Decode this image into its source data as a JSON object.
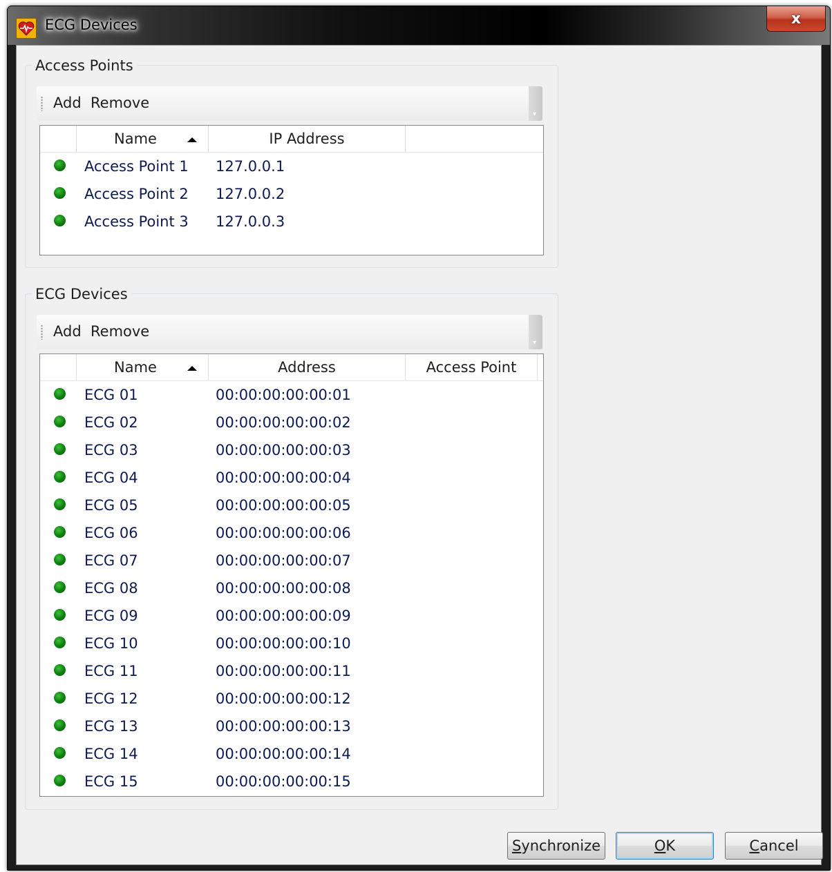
{
  "window": {
    "title": "ECG Devices",
    "close_label": "x"
  },
  "access_points": {
    "group_title": "Access Points",
    "toolbar": {
      "add_label": "Add",
      "remove_label": "Remove"
    },
    "columns": [
      "Name",
      "IP Address"
    ],
    "rows": [
      {
        "name": "Access Point 1",
        "ip": "127.0.0.1",
        "status": "online"
      },
      {
        "name": "Access Point 2",
        "ip": "127.0.0.2",
        "status": "online"
      },
      {
        "name": "Access Point 3",
        "ip": "127.0.0.3",
        "status": "online"
      }
    ]
  },
  "ecg_devices": {
    "group_title": "ECG Devices",
    "toolbar": {
      "add_label": "Add",
      "remove_label": "Remove"
    },
    "columns": [
      "Name",
      "Address",
      "Access Point"
    ],
    "rows": [
      {
        "name": "ECG 01",
        "address": "00:00:00:00:00:01",
        "access_point": "",
        "status": "online"
      },
      {
        "name": "ECG 02",
        "address": "00:00:00:00:00:02",
        "access_point": "",
        "status": "online"
      },
      {
        "name": "ECG 03",
        "address": "00:00:00:00:00:03",
        "access_point": "",
        "status": "online"
      },
      {
        "name": "ECG 04",
        "address": "00:00:00:00:00:04",
        "access_point": "",
        "status": "online"
      },
      {
        "name": "ECG 05",
        "address": "00:00:00:00:00:05",
        "access_point": "",
        "status": "online"
      },
      {
        "name": "ECG 06",
        "address": "00:00:00:00:00:06",
        "access_point": "",
        "status": "online"
      },
      {
        "name": "ECG 07",
        "address": "00:00:00:00:00:07",
        "access_point": "",
        "status": "online"
      },
      {
        "name": "ECG 08",
        "address": "00:00:00:00:00:08",
        "access_point": "",
        "status": "online"
      },
      {
        "name": "ECG 09",
        "address": "00:00:00:00:00:09",
        "access_point": "",
        "status": "online"
      },
      {
        "name": "ECG 10",
        "address": "00:00:00:00:00:10",
        "access_point": "",
        "status": "online"
      },
      {
        "name": "ECG 11",
        "address": "00:00:00:00:00:11",
        "access_point": "",
        "status": "online"
      },
      {
        "name": "ECG 12",
        "address": "00:00:00:00:00:12",
        "access_point": "",
        "status": "online"
      },
      {
        "name": "ECG 13",
        "address": "00:00:00:00:00:13",
        "access_point": "",
        "status": "online"
      },
      {
        "name": "ECG 14",
        "address": "00:00:00:00:00:14",
        "access_point": "",
        "status": "online"
      },
      {
        "name": "ECG 15",
        "address": "00:00:00:00:00:15",
        "access_point": "",
        "status": "online"
      }
    ]
  },
  "buttons": {
    "synchronize": {
      "mnemonic": "S",
      "rest": "ynchronize"
    },
    "ok": {
      "mnemonic": "O",
      "rest": "K"
    },
    "cancel": {
      "mnemonic": "C",
      "rest": "ancel"
    }
  },
  "colors": {
    "status_online": "#138a13",
    "row_text": "#0e1a55",
    "dialog_bg": "#f0f0f0"
  }
}
